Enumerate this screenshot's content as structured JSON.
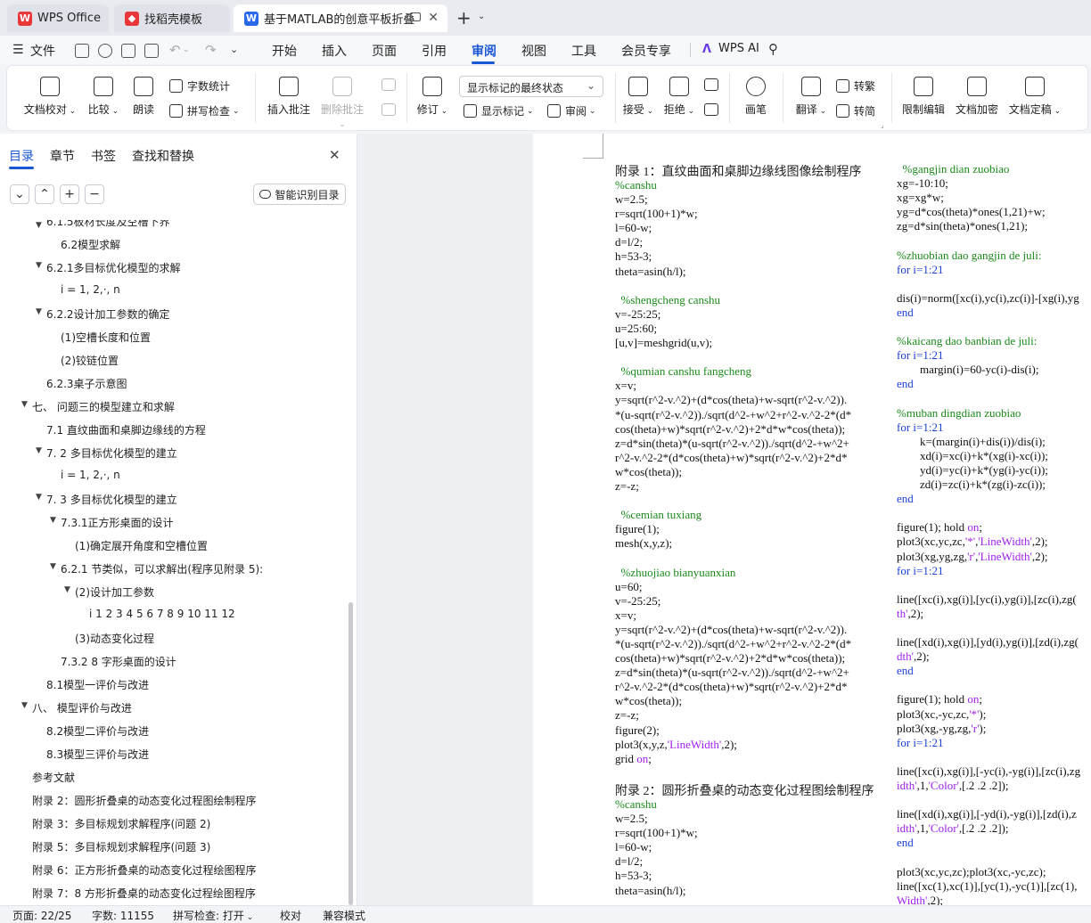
{
  "tabs": [
    {
      "label": "WPS Office",
      "icon": "wps-logo-icon"
    },
    {
      "label": "找稻壳模板",
      "icon": "docer-icon"
    },
    {
      "label": "基于MATLAB的创意平板折叠",
      "icon": "writer-doc-icon"
    }
  ],
  "menu": {
    "file": "文件",
    "items": [
      "开始",
      "插入",
      "页面",
      "引用",
      "审阅",
      "视图",
      "工具",
      "会员专享"
    ],
    "active": "审阅",
    "ai": "WPS AI"
  },
  "ribbon": {
    "doc_check": "文档校对",
    "compare": "比较",
    "read_aloud": "朗读",
    "word_count": "字数统计",
    "spell_check": "拼写检查",
    "insert_comment": "插入批注",
    "delete_comment": "删除批注",
    "revise": "修订",
    "markup_state": "显示标记的最终状态",
    "show_markup": "显示标记",
    "review": "审阅",
    "accept": "接受",
    "reject": "拒绝",
    "pen": "画笔",
    "translate": "翻译",
    "to_traditional": "转繁",
    "to_simplified": "转简",
    "restrict_edit": "限制编辑",
    "doc_encrypt": "文档加密",
    "doc_finalize": "文档定稿"
  },
  "sidebar": {
    "tabs": [
      "目录",
      "章节",
      "书签",
      "查找和替换"
    ],
    "smart_toc": "智能识别目录",
    "items": [
      {
        "text": "6.1.5板材长度及空槽下界",
        "level": 2,
        "toggle": true
      },
      {
        "text": "6.2模型求解",
        "level": 3,
        "toggle": false
      },
      {
        "text": "6.2.1多目标优化模型的求解",
        "level": 2,
        "toggle": true
      },
      {
        "text": "i = 1, 2,·, n",
        "level": 3,
        "toggle": false
      },
      {
        "text": "6.2.2设计加工参数的确定",
        "level": 2,
        "toggle": true
      },
      {
        "text": "(1)空槽长度和位置",
        "level": 3,
        "toggle": false
      },
      {
        "text": "(2)铰链位置",
        "level": 3,
        "toggle": false
      },
      {
        "text": "6.2.3桌子示意图",
        "level": 2,
        "toggle": false
      },
      {
        "text": "七、 问题三的模型建立和求解",
        "level": 1,
        "toggle": true
      },
      {
        "text": "7.1 直纹曲面和桌脚边缘线的方程",
        "level": 2,
        "toggle": false
      },
      {
        "text": "7. 2 多目标优化模型的建立",
        "level": 2,
        "toggle": true
      },
      {
        "text": "i = 1, 2,·, n",
        "level": 3,
        "toggle": false
      },
      {
        "text": "7. 3 多目标优化模型的建立",
        "level": 2,
        "toggle": true
      },
      {
        "text": "7.3.1正方形桌面的设计",
        "level": 3,
        "toggle": true
      },
      {
        "text": "(1)确定展开角度和空槽位置",
        "level": 4,
        "toggle": false
      },
      {
        "text": "6.2.1 节类似，可以求解出(程序见附录 5):",
        "level": 3,
        "toggle": true
      },
      {
        "text": "(2)设计加工参数",
        "level": 4,
        "toggle": true
      },
      {
        "text": "i 1 2 3 4 5 6 7 8 9 10 11 12",
        "level": 5,
        "toggle": false
      },
      {
        "text": "(3)动态变化过程",
        "level": 4,
        "toggle": false
      },
      {
        "text": "7.3.2 8 字形桌面的设计",
        "level": 3,
        "toggle": false
      },
      {
        "text": "8.1模型一评价与改进",
        "level": 2,
        "toggle": false
      },
      {
        "text": "八、 模型评价与改进",
        "level": 1,
        "toggle": true
      },
      {
        "text": "8.2模型二评价与改进",
        "level": 2,
        "toggle": false
      },
      {
        "text": "8.3模型三评价与改进",
        "level": 2,
        "toggle": false
      },
      {
        "text": "参考文献",
        "level": 1,
        "toggle": false
      },
      {
        "text": "附录 2：圆形折叠桌的动态变化过程图绘制程序",
        "level": 1,
        "toggle": false
      },
      {
        "text": "附录 3：多目标规划求解程序(问题 2)",
        "level": 1,
        "toggle": false
      },
      {
        "text": "附录 5：多目标规划求解程序(问题 3)",
        "level": 1,
        "toggle": false
      },
      {
        "text": "附录 6：正方形折叠桌的动态变化过程绘图程序",
        "level": 1,
        "toggle": false
      },
      {
        "text": "附录 7：8 方形折叠桌的动态变化过程绘图程序",
        "level": 1,
        "toggle": false
      }
    ]
  },
  "document": {
    "appendix1_title": "附录 1：直纹曲面和桌脚边缘线图像绘制程序",
    "appendix2_title": "附录 2：圆形折叠桌的动态变化过程图绘制程序",
    "left_lines_1": [
      [
        "g",
        "%canshu"
      ],
      [
        "k",
        "w=2.5;"
      ],
      [
        "k",
        "r=sqrt(100+1)*w;"
      ],
      [
        "k",
        "l=60-w;"
      ],
      [
        "k",
        "d=l/2;"
      ],
      [
        "k",
        "h=53-3;"
      ],
      [
        "k",
        "theta=asin(h/l);"
      ],
      [
        "k",
        ""
      ],
      [
        "g",
        "  %shengcheng canshu"
      ],
      [
        "k",
        "v=-25:25;"
      ],
      [
        "k",
        "u=25:60;"
      ],
      [
        "k",
        "[u,v]=meshgrid(u,v);"
      ],
      [
        "k",
        ""
      ],
      [
        "g",
        "  %qumian canshu fangcheng"
      ],
      [
        "k",
        "x=v;"
      ],
      [
        "k",
        "y=sqrt(r^2-v.^2)+(d*cos(theta)+w-sqrt(r^2-v.^2))."
      ],
      [
        "k",
        "*(u-sqrt(r^2-v.^2))./sqrt(d^2-+w^2+r^2-v.^2-2*(d*"
      ],
      [
        "k",
        "cos(theta)+w)*sqrt(r^2-v.^2)+2*d*w*cos(theta));"
      ],
      [
        "k",
        "z=d*sin(theta)*(u-sqrt(r^2-v.^2))./sqrt(d^2-+w^2+"
      ],
      [
        "k",
        "r^2-v.^2-2*(d*cos(theta)+w)*sqrt(r^2-v.^2)+2*d*"
      ],
      [
        "k",
        "w*cos(theta));"
      ],
      [
        "k",
        "z=-z;"
      ],
      [
        "k",
        ""
      ],
      [
        "g",
        "  %cemian tuxiang"
      ],
      [
        "k",
        "figure(1);"
      ],
      [
        "k",
        "mesh(x,y,z);"
      ],
      [
        "k",
        ""
      ],
      [
        "g",
        "  %zhuojiao bianyuanxian"
      ],
      [
        "k",
        "u=60;"
      ],
      [
        "k",
        "v=-25:25;"
      ],
      [
        "k",
        "x=v;"
      ],
      [
        "k",
        "y=sqrt(r^2-v.^2)+(d*cos(theta)+w-sqrt(r^2-v.^2))."
      ],
      [
        "k",
        "*(u-sqrt(r^2-v.^2))./sqrt(d^2-+w^2+r^2-v.^2-2*(d*"
      ],
      [
        "k",
        "cos(theta)+w)*sqrt(r^2-v.^2)+2*d*w*cos(theta));"
      ],
      [
        "k",
        "z=d*sin(theta)*(u-sqrt(r^2-v.^2))./sqrt(d^2-+w^2+"
      ],
      [
        "k",
        "r^2-v.^2-2*(d*cos(theta)+w)*sqrt(r^2-v.^2)+2*d*"
      ],
      [
        "k",
        "w*cos(theta));"
      ],
      [
        "k",
        "z=-z;"
      ],
      [
        "k",
        "figure(2);"
      ],
      [
        "m",
        "plot3(x,y,z,|'LineWidth'|,2);"
      ],
      [
        "m",
        "grid |on|;"
      ]
    ],
    "left_lines_2": [
      [
        "g",
        "%canshu"
      ],
      [
        "k",
        "w=2.5;"
      ],
      [
        "k",
        "r=sqrt(100+1)*w;"
      ],
      [
        "k",
        "l=60-w;"
      ],
      [
        "k",
        "d=l/2;"
      ],
      [
        "k",
        "h=53-3;"
      ],
      [
        "k",
        "theta=asin(h/l);"
      ]
    ],
    "right_lines": [
      [
        "g",
        "  %gangjin dian zuobiao"
      ],
      [
        "k",
        "xg=-10:10;"
      ],
      [
        "k",
        "xg=xg*w;"
      ],
      [
        "k",
        "yg=d*cos(theta)*ones(1,21)+w;"
      ],
      [
        "k",
        "zg=d*sin(theta)*ones(1,21);"
      ],
      [
        "k",
        ""
      ],
      [
        "g",
        "%zhuobian dao gangjin de juli:"
      ],
      [
        "b",
        "for i=1:21"
      ],
      [
        "k",
        ""
      ],
      [
        "k",
        "dis(i)=norm([xc(i),yc(i),zc(i)]-[xg(i),yg"
      ],
      [
        "b",
        "end"
      ],
      [
        "k",
        ""
      ],
      [
        "g",
        "%kaicang dao banbian de juli:"
      ],
      [
        "b",
        "for i=1:21"
      ],
      [
        "k",
        "        margin(i)=60-yc(i)-dis(i);"
      ],
      [
        "b",
        "end"
      ],
      [
        "k",
        ""
      ],
      [
        "g",
        "%muban dingdian zuobiao"
      ],
      [
        "b",
        "for i=1:21"
      ],
      [
        "k",
        "        k=(margin(i)+dis(i))/dis(i);"
      ],
      [
        "k",
        "        xd(i)=xc(i)+k*(xg(i)-xc(i));"
      ],
      [
        "k",
        "        yd(i)=yc(i)+k*(yg(i)-yc(i));"
      ],
      [
        "k",
        "        zd(i)=zc(i)+k*(zg(i)-zc(i));"
      ],
      [
        "b",
        "end"
      ],
      [
        "k",
        ""
      ],
      [
        "m",
        "figure(1); hold |on|;"
      ],
      [
        "m",
        "plot3(xc,yc,zc,|'*'|,|'LineWidth'|,2);"
      ],
      [
        "m",
        "plot3(xg,yg,zg,|'r'|,|'LineWidth'|,2);"
      ],
      [
        "b",
        "for i=1:21"
      ],
      [
        "k",
        ""
      ],
      [
        "k",
        "line([xc(i),xg(i)],[yc(i),yg(i)],[zc(i),zg("
      ],
      [
        "m",
        "|th'|,2);"
      ],
      [
        "k",
        ""
      ],
      [
        "k",
        "line([xd(i),xg(i)],[yd(i),yg(i)],[zd(i),zg("
      ],
      [
        "m",
        "|dth'|,2);"
      ],
      [
        "b",
        "end"
      ],
      [
        "k",
        ""
      ],
      [
        "m",
        "figure(1); hold |on|;"
      ],
      [
        "m",
        "plot3(xc,-yc,zc,|'*'|);"
      ],
      [
        "m",
        "plot3(xg,-yg,zg,|'r'|);"
      ],
      [
        "b",
        "for i=1:21"
      ],
      [
        "k",
        ""
      ],
      [
        "k",
        "line([xc(i),xg(i)],[-yc(i),-yg(i)],[zc(i),zg"
      ],
      [
        "m",
        "|idth'|,1,|'Color'|,[.2 .2 .2]);"
      ],
      [
        "k",
        ""
      ],
      [
        "k",
        "line([xd(i),xg(i)],[-yd(i),-yg(i)],[zd(i),z"
      ],
      [
        "m",
        "|idth'|,1,|'Color'|,[.2 .2 .2]);"
      ],
      [
        "b",
        "end"
      ],
      [
        "k",
        ""
      ],
      [
        "k",
        "plot3(xc,yc,zc);plot3(xc,-yc,zc);"
      ],
      [
        "k",
        "line([xc(1),xc(1)],[yc(1),-yc(1)],[zc(1),"
      ],
      [
        "m",
        "|Width'|,2);"
      ]
    ]
  },
  "statusbar": {
    "page": "页面: 22/25",
    "words": "字数: 11155",
    "spell": "拼写检查: 打开",
    "proof": "校对",
    "compat": "兼容模式"
  },
  "colors": {
    "accent": "#1a57d6",
    "comment_green": "#1a8a1a",
    "keyword_blue": "#1a3fd6",
    "string_purple": "#a020f0"
  }
}
